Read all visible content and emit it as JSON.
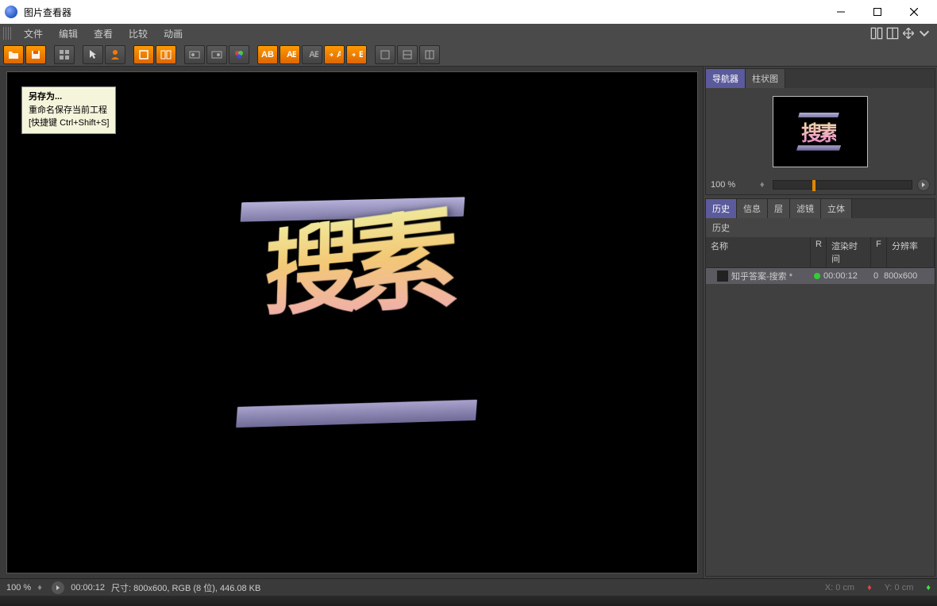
{
  "window": {
    "title": "图片查看器"
  },
  "menu": {
    "items": [
      "文件",
      "编辑",
      "查看",
      "比较",
      "动画"
    ]
  },
  "tooltip": {
    "title": "另存为...",
    "desc": "重命名保存当前工程",
    "shortcut": "[快捷键 Ctrl+Shift+S]"
  },
  "render_text": "搜素",
  "sidepanel": {
    "nav_tabs": [
      "导航器",
      "柱状图"
    ],
    "zoom": "100 %",
    "hist_tabs": [
      "历史",
      "信息",
      "层",
      "滤镜",
      "立体"
    ],
    "history_label": "历史",
    "columns": {
      "name": "名称",
      "r": "R",
      "time": "渲染时间",
      "f": "F",
      "res": "分辨率"
    },
    "row": {
      "name": "知乎答案-搜索 *",
      "time": "00:00:12",
      "f": "0",
      "res": "800x600"
    }
  },
  "status": {
    "zoom": "100 %",
    "time": "00:00:12",
    "info": "尺寸: 800x600, RGB (8 位), 446.08 KB",
    "coord_x": "X: 0 cm",
    "coord_y": "Y: 0 cm"
  }
}
